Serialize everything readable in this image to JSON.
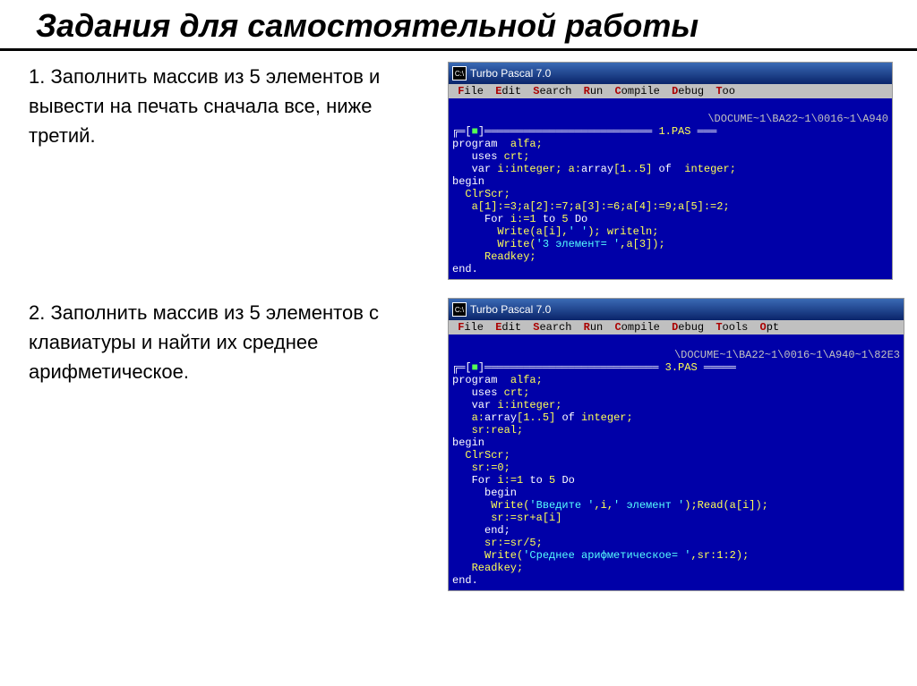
{
  "page_title": "Задания для самостоятельной работы",
  "tasks": {
    "t1": "1. Заполнить массив из 5 элементов и вывести на печать сначала все, ниже третий.",
    "t2": "2. Заполнить массив из 5 элементов с клавиатуры и найти их среднее арифметическое."
  },
  "ide": {
    "window_title": "Turbo Pascal 7.0",
    "cmd_prefix": "C:\\",
    "menus": [
      "File",
      "Edit",
      "Search",
      "Run",
      "Compile",
      "Debug",
      "Tools",
      "Options"
    ],
    "path1": "\\DOCUME~1\\BA22~1\\0016~1\\A940",
    "file1": "1.PAS",
    "path2": "\\DOCUME~1\\BA22~1\\0016~1\\A940~1\\82E3",
    "file2": "3.PAS",
    "code1": {
      "l1a": "program",
      "l1b": "  alfa;",
      "l2a": "   uses",
      "l2b": " crt;",
      "l3a": "   var",
      "l3b": " i:integer; a:",
      "l3c": "array",
      "l3d": "[1..5] ",
      "l3e": "of",
      "l3f": "  integer;",
      "l4": "begin",
      "l5": "  ClrScr;",
      "l6": "   a[1]:=3;a[2]:=7;a[3]:=6;a[4]:=9;a[5]:=2;",
      "l7a": "     For",
      "l7b": " i:=1 ",
      "l7c": "to",
      "l7d": " 5 ",
      "l7e": "Do",
      "l8a": "       Write(a[i],",
      "l8b": "' '",
      "l8c": "); writeln;",
      "l9a": "       Write(",
      "l9b": "'3 элемент= '",
      "l9c": ",a[3]);",
      "l10": "     Readkey;",
      "l11": "end."
    },
    "code2": {
      "l1a": "program",
      "l1b": "  alfa;",
      "l2a": "   uses",
      "l2b": " crt;",
      "l3a": "   var",
      "l3b": " i:integer;",
      "l4a": "   a:",
      "l4b": "array",
      "l4c": "[1..5] ",
      "l4d": "of",
      "l4e": " integer;",
      "l5": "   sr:real;",
      "l6": "begin",
      "l7": "  ClrScr;",
      "l8": "   sr:=0;",
      "l9a": "   For",
      "l9b": " i:=1 ",
      "l9c": "to",
      "l9d": " 5 ",
      "l9e": "Do",
      "l10": "     begin",
      "l11a": "      Write(",
      "l11b": "'Введите '",
      "l11c": ",i,",
      "l11d": "' элемент '",
      "l11e": ");Read(a[i]);",
      "l12": "      sr:=sr+a[i]",
      "l13": "     end;",
      "l14": "     sr:=sr/5;",
      "l15a": "     Write(",
      "l15b": "'Среднее арифметическое= '",
      "l15c": ",sr:1:2);",
      "l16": "   Readkey;",
      "l17": "end."
    }
  }
}
